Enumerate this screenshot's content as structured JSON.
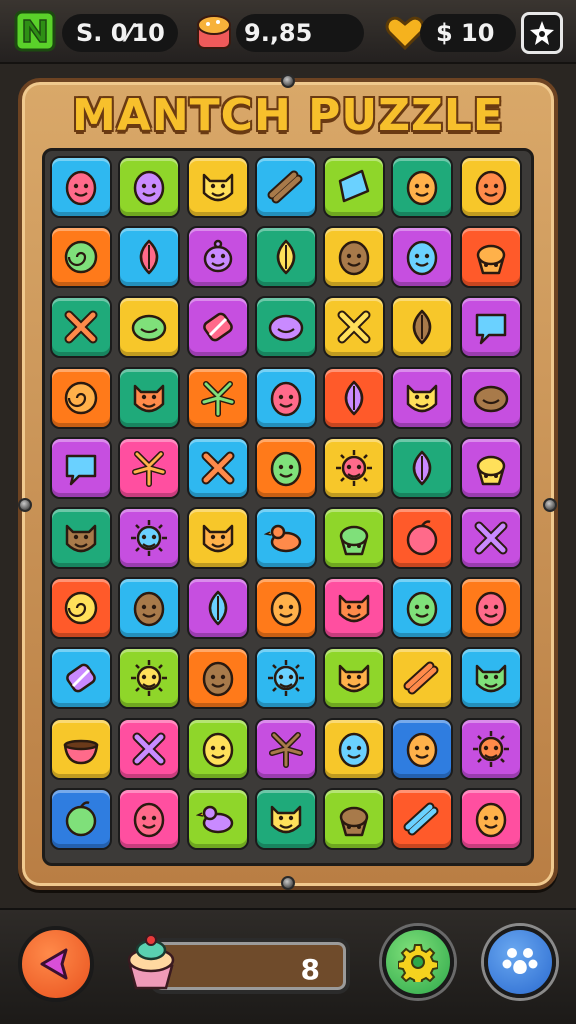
{
  "hud": {
    "left_value": "S.  0⁄10",
    "middle_value": "9.,85",
    "right_value": "$  10",
    "icons": [
      "green-n-gem-icon",
      "candy-icon",
      "gold-heart-icon",
      "star-settings-icon"
    ]
  },
  "title": "MANTCH PUZZLE",
  "board": {
    "rows": [
      [
        {
          "c": "#2fb8f0",
          "i": "face"
        },
        {
          "c": "#8fd62a",
          "i": "face"
        },
        {
          "c": "#f7c72a",
          "i": "cat"
        },
        {
          "c": "#2fb8f0",
          "i": "bone"
        },
        {
          "c": "#8fd62a",
          "i": "cup"
        },
        {
          "c": "#1faa7a",
          "i": "face"
        },
        {
          "c": "#f7c72a",
          "i": "face"
        }
      ],
      [
        {
          "c": "#ff7a1a",
          "i": "swirl"
        },
        {
          "c": "#2fb8f0",
          "i": "leaf"
        },
        {
          "c": "#c64fe0",
          "i": "robot"
        },
        {
          "c": "#1faa7a",
          "i": "leaf"
        },
        {
          "c": "#f7c72a",
          "i": "face"
        },
        {
          "c": "#c64fe0",
          "i": "face"
        },
        {
          "c": "#ff5a2a",
          "i": "cupcake"
        }
      ],
      [
        {
          "c": "#1faa7a",
          "i": "cross"
        },
        {
          "c": "#f7c72a",
          "i": "blob"
        },
        {
          "c": "#c64fe0",
          "i": "candy"
        },
        {
          "c": "#1faa7a",
          "i": "blob"
        },
        {
          "c": "#f7c72a",
          "i": "cross"
        },
        {
          "c": "#f7c72a",
          "i": "leaf"
        },
        {
          "c": "#c64fe0",
          "i": "bubble"
        }
      ],
      [
        {
          "c": "#ff7a1a",
          "i": "swirl"
        },
        {
          "c": "#1faa7a",
          "i": "cat"
        },
        {
          "c": "#ff7a1a",
          "i": "plant"
        },
        {
          "c": "#2fb8f0",
          "i": "face"
        },
        {
          "c": "#ff5a2a",
          "i": "leaf"
        },
        {
          "c": "#c64fe0",
          "i": "cat"
        },
        {
          "c": "#c64fe0",
          "i": "blob"
        }
      ],
      [
        {
          "c": "#c64fe0",
          "i": "bubble"
        },
        {
          "c": "#ff4fa0",
          "i": "plant"
        },
        {
          "c": "#2fb8f0",
          "i": "cross"
        },
        {
          "c": "#ff7a1a",
          "i": "face"
        },
        {
          "c": "#f7c72a",
          "i": "sun"
        },
        {
          "c": "#1faa7a",
          "i": "leaf"
        },
        {
          "c": "#c64fe0",
          "i": "cupcake"
        }
      ],
      [
        {
          "c": "#1faa7a",
          "i": "cat"
        },
        {
          "c": "#c64fe0",
          "i": "sun"
        },
        {
          "c": "#f7c72a",
          "i": "cat"
        },
        {
          "c": "#2fb8f0",
          "i": "bird"
        },
        {
          "c": "#8fd62a",
          "i": "cupcake"
        },
        {
          "c": "#ff5a2a",
          "i": "apple"
        },
        {
          "c": "#c64fe0",
          "i": "cross"
        }
      ],
      [
        {
          "c": "#ff5a2a",
          "i": "swirl"
        },
        {
          "c": "#2fb8f0",
          "i": "face"
        },
        {
          "c": "#c64fe0",
          "i": "leaf"
        },
        {
          "c": "#ff7a1a",
          "i": "face"
        },
        {
          "c": "#ff4fa0",
          "i": "cat"
        },
        {
          "c": "#2fb8f0",
          "i": "face"
        },
        {
          "c": "#ff7a1a",
          "i": "face"
        }
      ],
      [
        {
          "c": "#2fb8f0",
          "i": "candy"
        },
        {
          "c": "#8fd62a",
          "i": "sun"
        },
        {
          "c": "#ff7a1a",
          "i": "face"
        },
        {
          "c": "#2fb8f0",
          "i": "sun"
        },
        {
          "c": "#8fd62a",
          "i": "cat"
        },
        {
          "c": "#f7c72a",
          "i": "bone"
        },
        {
          "c": "#2fb8f0",
          "i": "cat"
        }
      ],
      [
        {
          "c": "#f7c72a",
          "i": "bowl"
        },
        {
          "c": "#ff4fa0",
          "i": "cross"
        },
        {
          "c": "#8fd62a",
          "i": "face"
        },
        {
          "c": "#c64fe0",
          "i": "plant"
        },
        {
          "c": "#f7c72a",
          "i": "face"
        },
        {
          "c": "#2f7de0",
          "i": "face"
        },
        {
          "c": "#c64fe0",
          "i": "sun"
        }
      ],
      [
        {
          "c": "#2f7de0",
          "i": "apple"
        },
        {
          "c": "#ff4fa0",
          "i": "face"
        },
        {
          "c": "#8fd62a",
          "i": "bird"
        },
        {
          "c": "#1faa7a",
          "i": "cat"
        },
        {
          "c": "#8fd62a",
          "i": "cupcake"
        },
        {
          "c": "#ff5a2a",
          "i": "bone"
        },
        {
          "c": "#ff4fa0",
          "i": "face"
        }
      ]
    ]
  },
  "bottom": {
    "counter_value": "8",
    "icons": [
      "back-arrow-icon",
      "cupcake-icon",
      "gear-icon",
      "paw-icon"
    ]
  }
}
